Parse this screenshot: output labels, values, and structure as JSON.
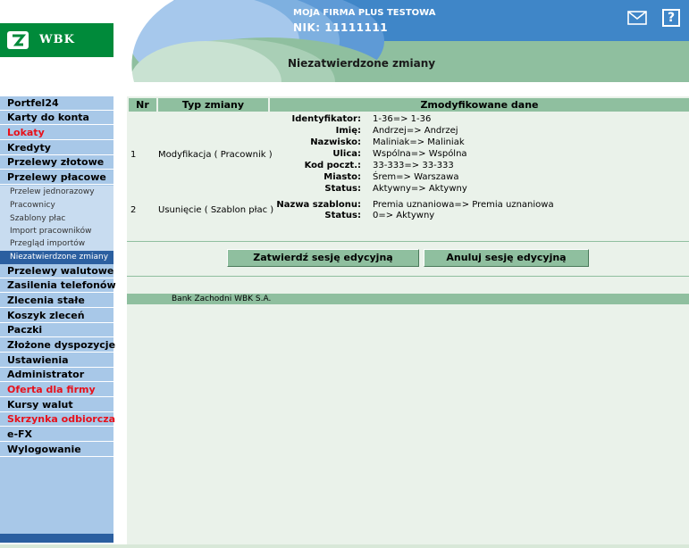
{
  "header": {
    "logo_text": "WBK",
    "company": "MOJA FIRMA PLUS TESTOWA",
    "nik": "NIK: 11111111",
    "page_title": "Niezatwierdzone zmiany",
    "icons": [
      "mail-icon",
      "help-icon"
    ],
    "help_glyph": "?"
  },
  "sidebar": {
    "items": [
      {
        "label": "Portfel24",
        "color": "#000000"
      },
      {
        "label": "Karty do konta",
        "color": "#000000"
      },
      {
        "label": "Lokaty",
        "color": "#e8101a"
      },
      {
        "label": "Kredyty",
        "color": "#000000"
      },
      {
        "label": "Przelewy złotowe",
        "color": "#000000"
      },
      {
        "label": "Przelewy płacowe",
        "color": "#000000"
      }
    ],
    "sub_items": [
      {
        "label": "Przelew jednorazowy"
      },
      {
        "label": "Pracownicy"
      },
      {
        "label": "Szablony płac"
      },
      {
        "label": "Import pracowników"
      },
      {
        "label": "Przegląd importów"
      },
      {
        "label": "Niezatwierdzone zmiany",
        "active": true
      }
    ],
    "items_after": [
      {
        "label": "Przelewy walutowe",
        "color": "#000000"
      },
      {
        "label": "Zasilenia telefonów",
        "color": "#000000"
      },
      {
        "label": "Zlecenia stałe",
        "color": "#000000"
      },
      {
        "label": "Koszyk zleceń",
        "color": "#000000"
      },
      {
        "label": "Paczki",
        "color": "#000000"
      },
      {
        "label": "Złożone dyspozycje",
        "color": "#000000"
      },
      {
        "label": "Ustawienia",
        "color": "#000000"
      },
      {
        "label": "Administrator",
        "color": "#000000"
      },
      {
        "label": "Oferta dla firmy",
        "color": "#e8101a"
      },
      {
        "label": "Kursy walut",
        "color": "#000000"
      },
      {
        "label": "Skrzynka odbiorcza",
        "color": "#e8101a"
      },
      {
        "label": "e-FX",
        "color": "#000000"
      },
      {
        "label": "Wylogowanie",
        "color": "#000000"
      }
    ]
  },
  "table": {
    "headers": [
      "Nr",
      "Typ zmiany",
      "Zmodyfikowane dane"
    ],
    "rows": [
      {
        "nr": "1",
        "type": "Modyfikacja ( Pracownik )",
        "fields": [
          {
            "label": "Identyfikator:",
            "value": "1-36=> 1-36"
          },
          {
            "label": "Imię:",
            "value": "Andrzej=> Andrzej"
          },
          {
            "label": "Nazwisko:",
            "value": "Maliniak=> Maliniak"
          },
          {
            "label": "Ulica:",
            "value": "Wspólna=> Wspólna"
          },
          {
            "label": "Kod poczt.:",
            "value": "33-333=> 33-333"
          },
          {
            "label": "Miasto:",
            "value": "Śrem=> Warszawa"
          },
          {
            "label": "Status:",
            "value": "Aktywny=> Aktywny"
          }
        ]
      },
      {
        "nr": "2",
        "type": "Usunięcie ( Szablon płac )",
        "fields": [
          {
            "label": "Nazwa szablonu:",
            "value": "Premia uznaniowa=> Premia uznaniowa"
          },
          {
            "label": "Status:",
            "value": "0=> Aktywny"
          }
        ]
      }
    ]
  },
  "buttons": {
    "confirm": "Zatwierdź sesję edycyjną",
    "cancel": "Anuluj sesję edycyjną"
  },
  "footer": {
    "text": "Bank Zachodni WBK S.A."
  },
  "colors": {
    "sidebar": "#a8c8e8",
    "sidebar_active": "#2b5fa0",
    "header_bar": "#8fbf9f",
    "content_bg": "#eaf2ea",
    "brand_green": "#008a3a",
    "alert_red": "#e8101a"
  }
}
